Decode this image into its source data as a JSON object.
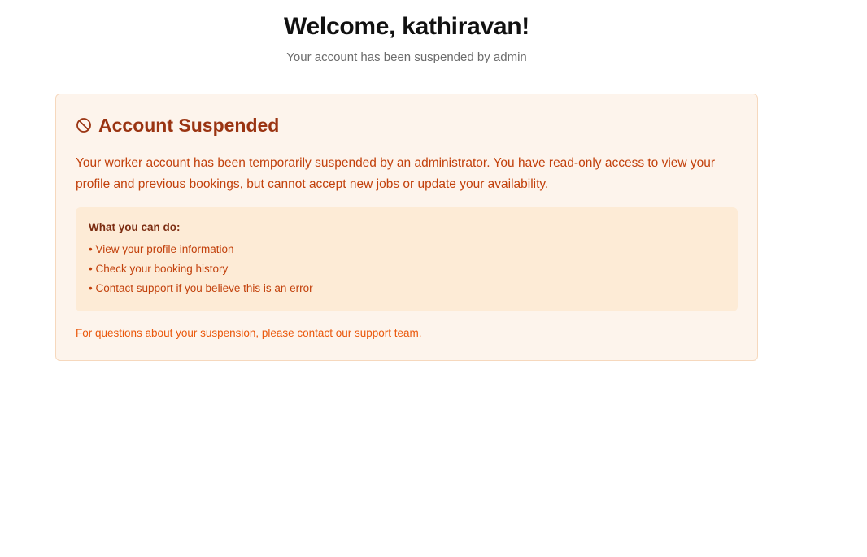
{
  "header": {
    "title": "Welcome, kathiravan!",
    "subtitle": "Your account has been suspended by admin"
  },
  "notice": {
    "icon": "ban-icon",
    "title": "Account Suspended",
    "description": "Your worker account has been temporarily suspended by an administrator. You have read-only access to view your profile and previous bookings, but cannot accept new jobs or update your availability.",
    "actions": {
      "heading": "What you can do:",
      "items": [
        "• View your profile information",
        "• Check your booking history",
        "• Contact support if you believe this is an error"
      ]
    },
    "footer": "For questions about your suspension, please contact our support team."
  },
  "colors": {
    "card_background": "#fdf4ec",
    "card_border": "#f6d8bd",
    "title_color": "#9a3412",
    "text_color": "#c2410c",
    "info_background": "#fdebd6"
  }
}
